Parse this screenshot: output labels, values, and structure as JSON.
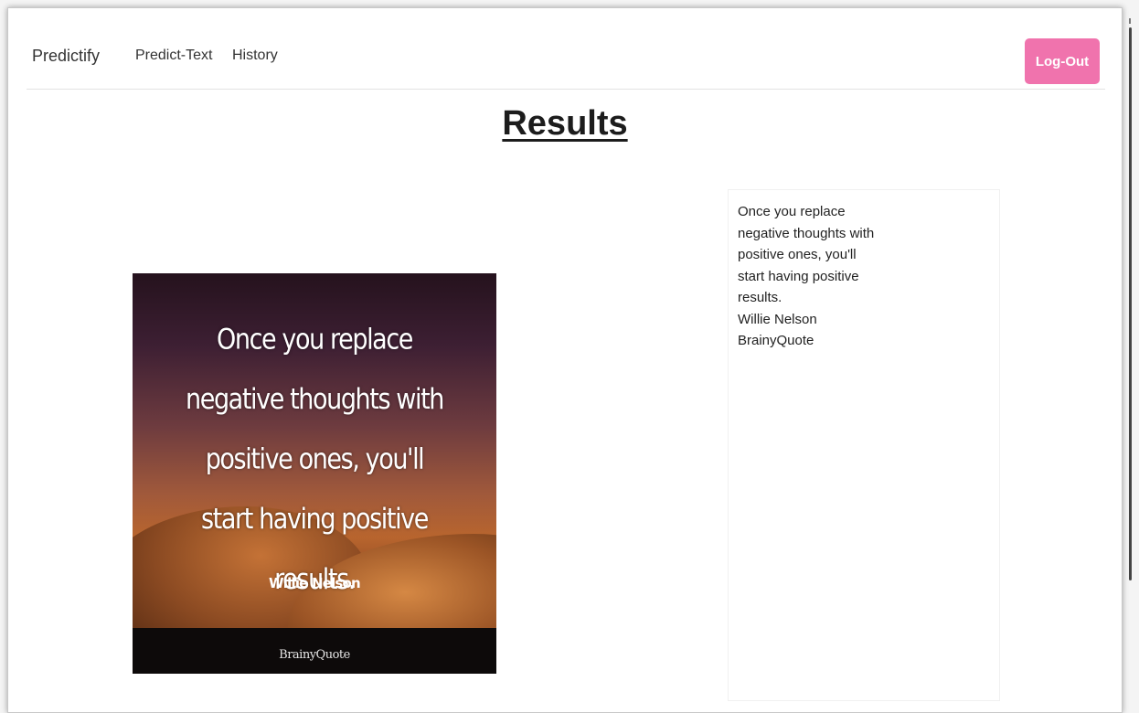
{
  "navbar": {
    "brand": "Predictify",
    "links": [
      "Predict-Text",
      "History"
    ],
    "logout_label": "Log-Out",
    "logout_color": "#f073ad"
  },
  "main": {
    "heading": "Results",
    "image": {
      "quote": "Once you replace\nnegative thoughts with\npositive ones, you'll\nstart having positive\nresults.",
      "author": "Willie Nelson",
      "source": "BrainyQuote"
    },
    "result_text": "Once you replace\nnegative thoughts with\npositive ones, you'll\nstart having positive\nresults.\nWillie Nelson\nBrainyQuote"
  }
}
